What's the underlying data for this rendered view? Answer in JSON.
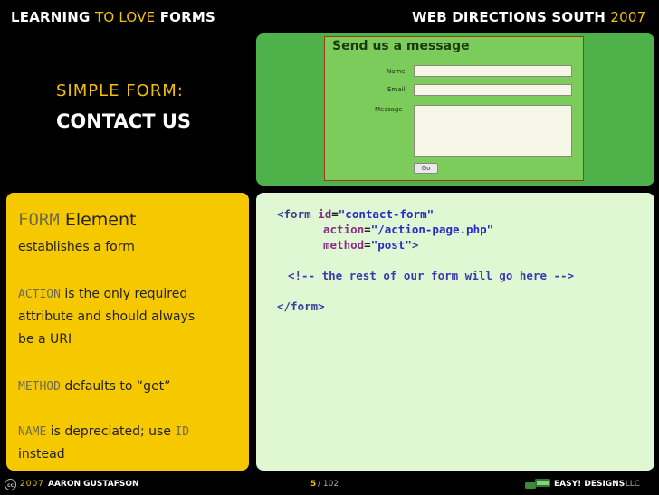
{
  "header": {
    "left": [
      "LEARNING",
      "TO LOVE",
      "FORMS"
    ],
    "right_name": "WEB DIRECTIONS SOUTH",
    "right_year": "2007"
  },
  "slide": {
    "subtitle": "SIMPLE FORM:",
    "title": "CONTACT US"
  },
  "screenshot": {
    "heading": "Send us a message",
    "name_label": "Name",
    "email_label": "Email",
    "message_label": "Message",
    "button": "Go"
  },
  "notes": {
    "heading_code": "FORM",
    "heading_text": "Element",
    "line1": "establishes a form",
    "action_code": "ACTION",
    "action_text1": "is the only required",
    "action_text2": "attribute and should always",
    "action_text3": "be a URI",
    "method_code": "METHOD",
    "method_text": "defaults to “get”",
    "name_code": "NAME",
    "name_text": "is depreciated; use",
    "id_code": "ID",
    "name_text2": "instead"
  },
  "code": {
    "tag_open": "<form",
    "attr_id": "id",
    "val_id": "\"contact-form\"",
    "attr_action": "action",
    "val_action": "\"/action-page.php\"",
    "attr_method": "method",
    "val_method": "\"post\"",
    "gt": ">",
    "comment": "<!-- the rest of our form will go here -->",
    "tag_close": "</form>"
  },
  "footer": {
    "cc": "cc",
    "year": "2007",
    "author": "AARON GUSTAFSON",
    "page": "5",
    "total": "/ 102",
    "company": "EASY! DESIGNS",
    "suffix": ", LLC"
  }
}
